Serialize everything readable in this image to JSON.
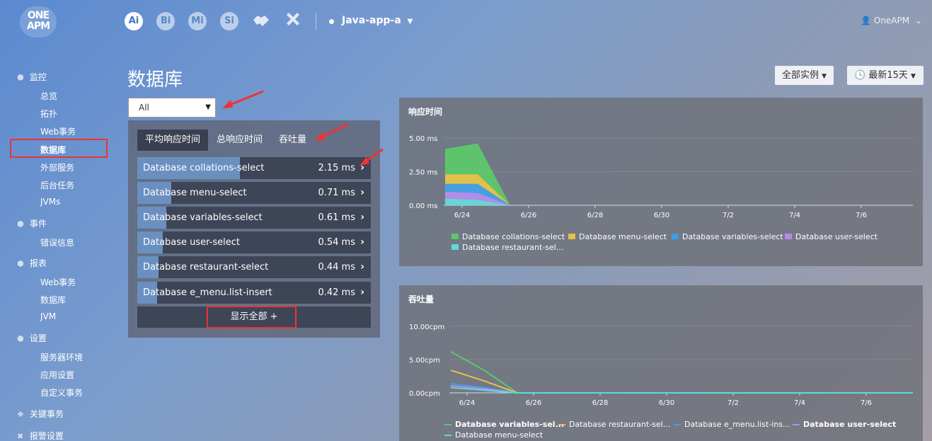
{
  "topbar": {
    "logo_line1": "ONE",
    "logo_line2": "APM",
    "products": [
      "Ai",
      "Bi",
      "Mi",
      "Si"
    ],
    "app_name": "Java-app-a",
    "user": "OneAPM"
  },
  "sidebar": {
    "groups": [
      {
        "label": "监控",
        "icon": "cube-icon"
      },
      {
        "label": "事件",
        "icon": "cube-icon"
      },
      {
        "label": "报表",
        "icon": "cube-icon"
      },
      {
        "label": "设置",
        "icon": "cube-icon"
      },
      {
        "label": "关键事务",
        "icon": "diamond-icon"
      },
      {
        "label": "报警设置",
        "icon": "wrench-icon"
      }
    ],
    "items": [
      "总览",
      "拓扑",
      "Web事务",
      "数据库",
      "外部服务",
      "后台任务",
      "JVMs",
      "错误信息",
      "Web事务",
      "数据库",
      "JVM",
      "服务器环境",
      "应用设置",
      "自定义事务"
    ]
  },
  "header": {
    "title": "数据库",
    "instances_btn": "全部实例",
    "time_btn": "最新15天"
  },
  "filter": {
    "selected": "All"
  },
  "tabs": [
    "平均响应时间",
    "总响应时间",
    "吞吐量"
  ],
  "rows": [
    {
      "name": "Database collations-select",
      "value": "2.15 ms",
      "fraction": 0.44
    },
    {
      "name": "Database menu-select",
      "value": "0.71 ms",
      "fraction": 0.145
    },
    {
      "name": "Database variables-select",
      "value": "0.61 ms",
      "fraction": 0.125
    },
    {
      "name": "Database user-select",
      "value": "0.54 ms",
      "fraction": 0.11
    },
    {
      "name": "Database restaurant-select",
      "value": "0.44 ms",
      "fraction": 0.09
    },
    {
      "name": "Database e_menu.list-insert",
      "value": "0.42 ms",
      "fraction": 0.085
    }
  ],
  "show_all": "显示全部 +",
  "chart_data": [
    {
      "type": "area",
      "title": "响应时间",
      "x": [
        "6/24",
        "6/26",
        "6/28",
        "6/30",
        "7/2",
        "7/4",
        "7/6"
      ],
      "yticks": [
        "5.00 ms",
        "2.50 ms",
        "0.00 ms"
      ],
      "ylim": [
        0,
        5
      ],
      "series": [
        {
          "name": "Database collations-select",
          "color": "#5cc86a",
          "values": [
            [
              0,
              4.2
            ],
            [
              0.5,
              4.6
            ],
            [
              1,
              0
            ]
          ]
        },
        {
          "name": "Database menu-select",
          "color": "#e8c04a",
          "values": [
            [
              0,
              2.3
            ],
            [
              0.5,
              2.3
            ],
            [
              1,
              0
            ]
          ]
        },
        {
          "name": "Database variables-select",
          "color": "#3d9ee8",
          "values": [
            [
              0,
              1.6
            ],
            [
              0.5,
              1.6
            ],
            [
              1,
              0
            ]
          ]
        },
        {
          "name": "Database user-select",
          "color": "#b98ae8",
          "values": [
            [
              0,
              1.0
            ],
            [
              0.5,
              0.9
            ],
            [
              1,
              0
            ]
          ]
        },
        {
          "name": "Database restaurant-sel...",
          "color": "#5fdad6",
          "values": [
            [
              0,
              0.5
            ],
            [
              0.5,
              0.4
            ],
            [
              1,
              0
            ]
          ]
        }
      ]
    },
    {
      "type": "line",
      "title": "吞吐量",
      "x": [
        "6/24",
        "6/26",
        "6/28",
        "6/30",
        "7/2",
        "7/4",
        "7/6"
      ],
      "yticks": [
        "10.00cpm",
        "5.00cpm",
        "0.00cpm"
      ],
      "ylim": [
        0,
        10
      ],
      "series": [
        {
          "name": "Database variables-sel...",
          "color": "#5cc86a",
          "values": [
            [
              0,
              6.2
            ],
            [
              0.5,
              3.4
            ],
            [
              1,
              0
            ]
          ]
        },
        {
          "name": "Database restaurant-sel...",
          "color": "#e8c04a",
          "values": [
            [
              0,
              3.4
            ],
            [
              0.5,
              1.8
            ],
            [
              1,
              0
            ]
          ]
        },
        {
          "name": "Database e_menu.list-ins...",
          "color": "#3d9ee8",
          "values": [
            [
              0,
              1.4
            ],
            [
              0.5,
              0.8
            ],
            [
              1,
              0
            ]
          ]
        },
        {
          "name": "Database user-select",
          "color": "#b98ae8",
          "values": [
            [
              0,
              1.1
            ],
            [
              0.5,
              0.6
            ],
            [
              1,
              0
            ]
          ]
        },
        {
          "name": "Database menu-select",
          "color": "#5fdad6",
          "values": [
            [
              0,
              0.8
            ],
            [
              0.5,
              0.4
            ],
            [
              1,
              0
            ]
          ]
        }
      ]
    }
  ]
}
